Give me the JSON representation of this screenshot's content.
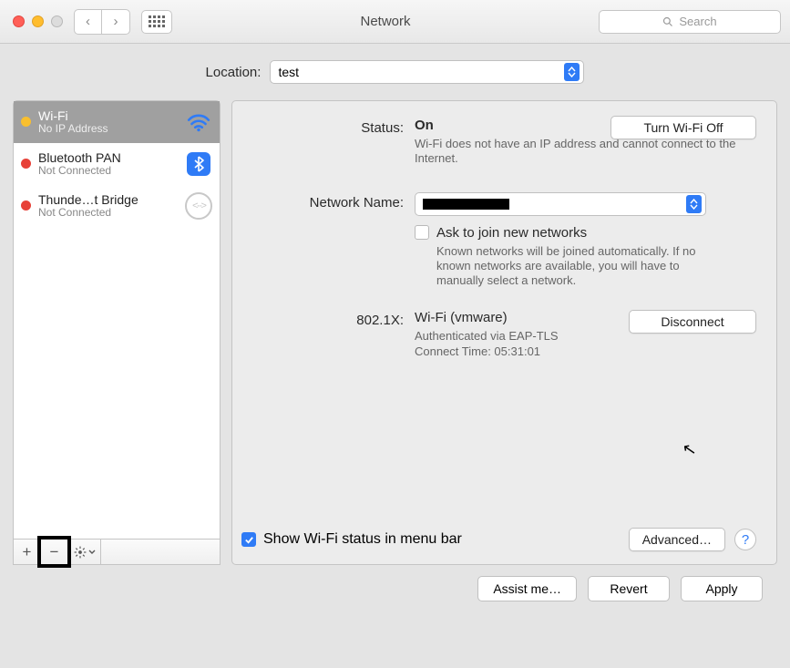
{
  "window": {
    "title": "Network",
    "search_placeholder": "Search"
  },
  "location": {
    "label": "Location:",
    "value": "test"
  },
  "sidebar": {
    "items": [
      {
        "name": "Wi-Fi",
        "status": "No IP Address",
        "dot": "y",
        "icon": "wifi"
      },
      {
        "name": "Bluetooth PAN",
        "status": "Not Connected",
        "dot": "r",
        "icon": "bluetooth"
      },
      {
        "name": "Thunde…t Bridge",
        "status": "Not Connected",
        "dot": "r",
        "icon": "thunderbolt"
      }
    ],
    "footer": {
      "add": "+",
      "remove": "−"
    }
  },
  "status": {
    "label": "Status:",
    "value": "On",
    "button": "Turn Wi-Fi Off",
    "sub": "Wi-Fi does not have an IP address and cannot connect to the Internet."
  },
  "network_name": {
    "label": "Network Name:",
    "value": ""
  },
  "ask_join": {
    "label": "Ask to join new networks",
    "sub": "Known networks will be joined automatically. If no known networks are available, you will have to manually select a network."
  },
  "x802": {
    "label": "802.1X:",
    "value": "Wi-Fi (vmware)",
    "button": "Disconnect",
    "auth": "Authenticated via EAP-TLS",
    "time": "Connect Time: 05:31:01"
  },
  "show_menu_bar": "Show Wi-Fi status in menu bar",
  "advanced": "Advanced…",
  "bottom": {
    "assist": "Assist me…",
    "revert": "Revert",
    "apply": "Apply"
  }
}
